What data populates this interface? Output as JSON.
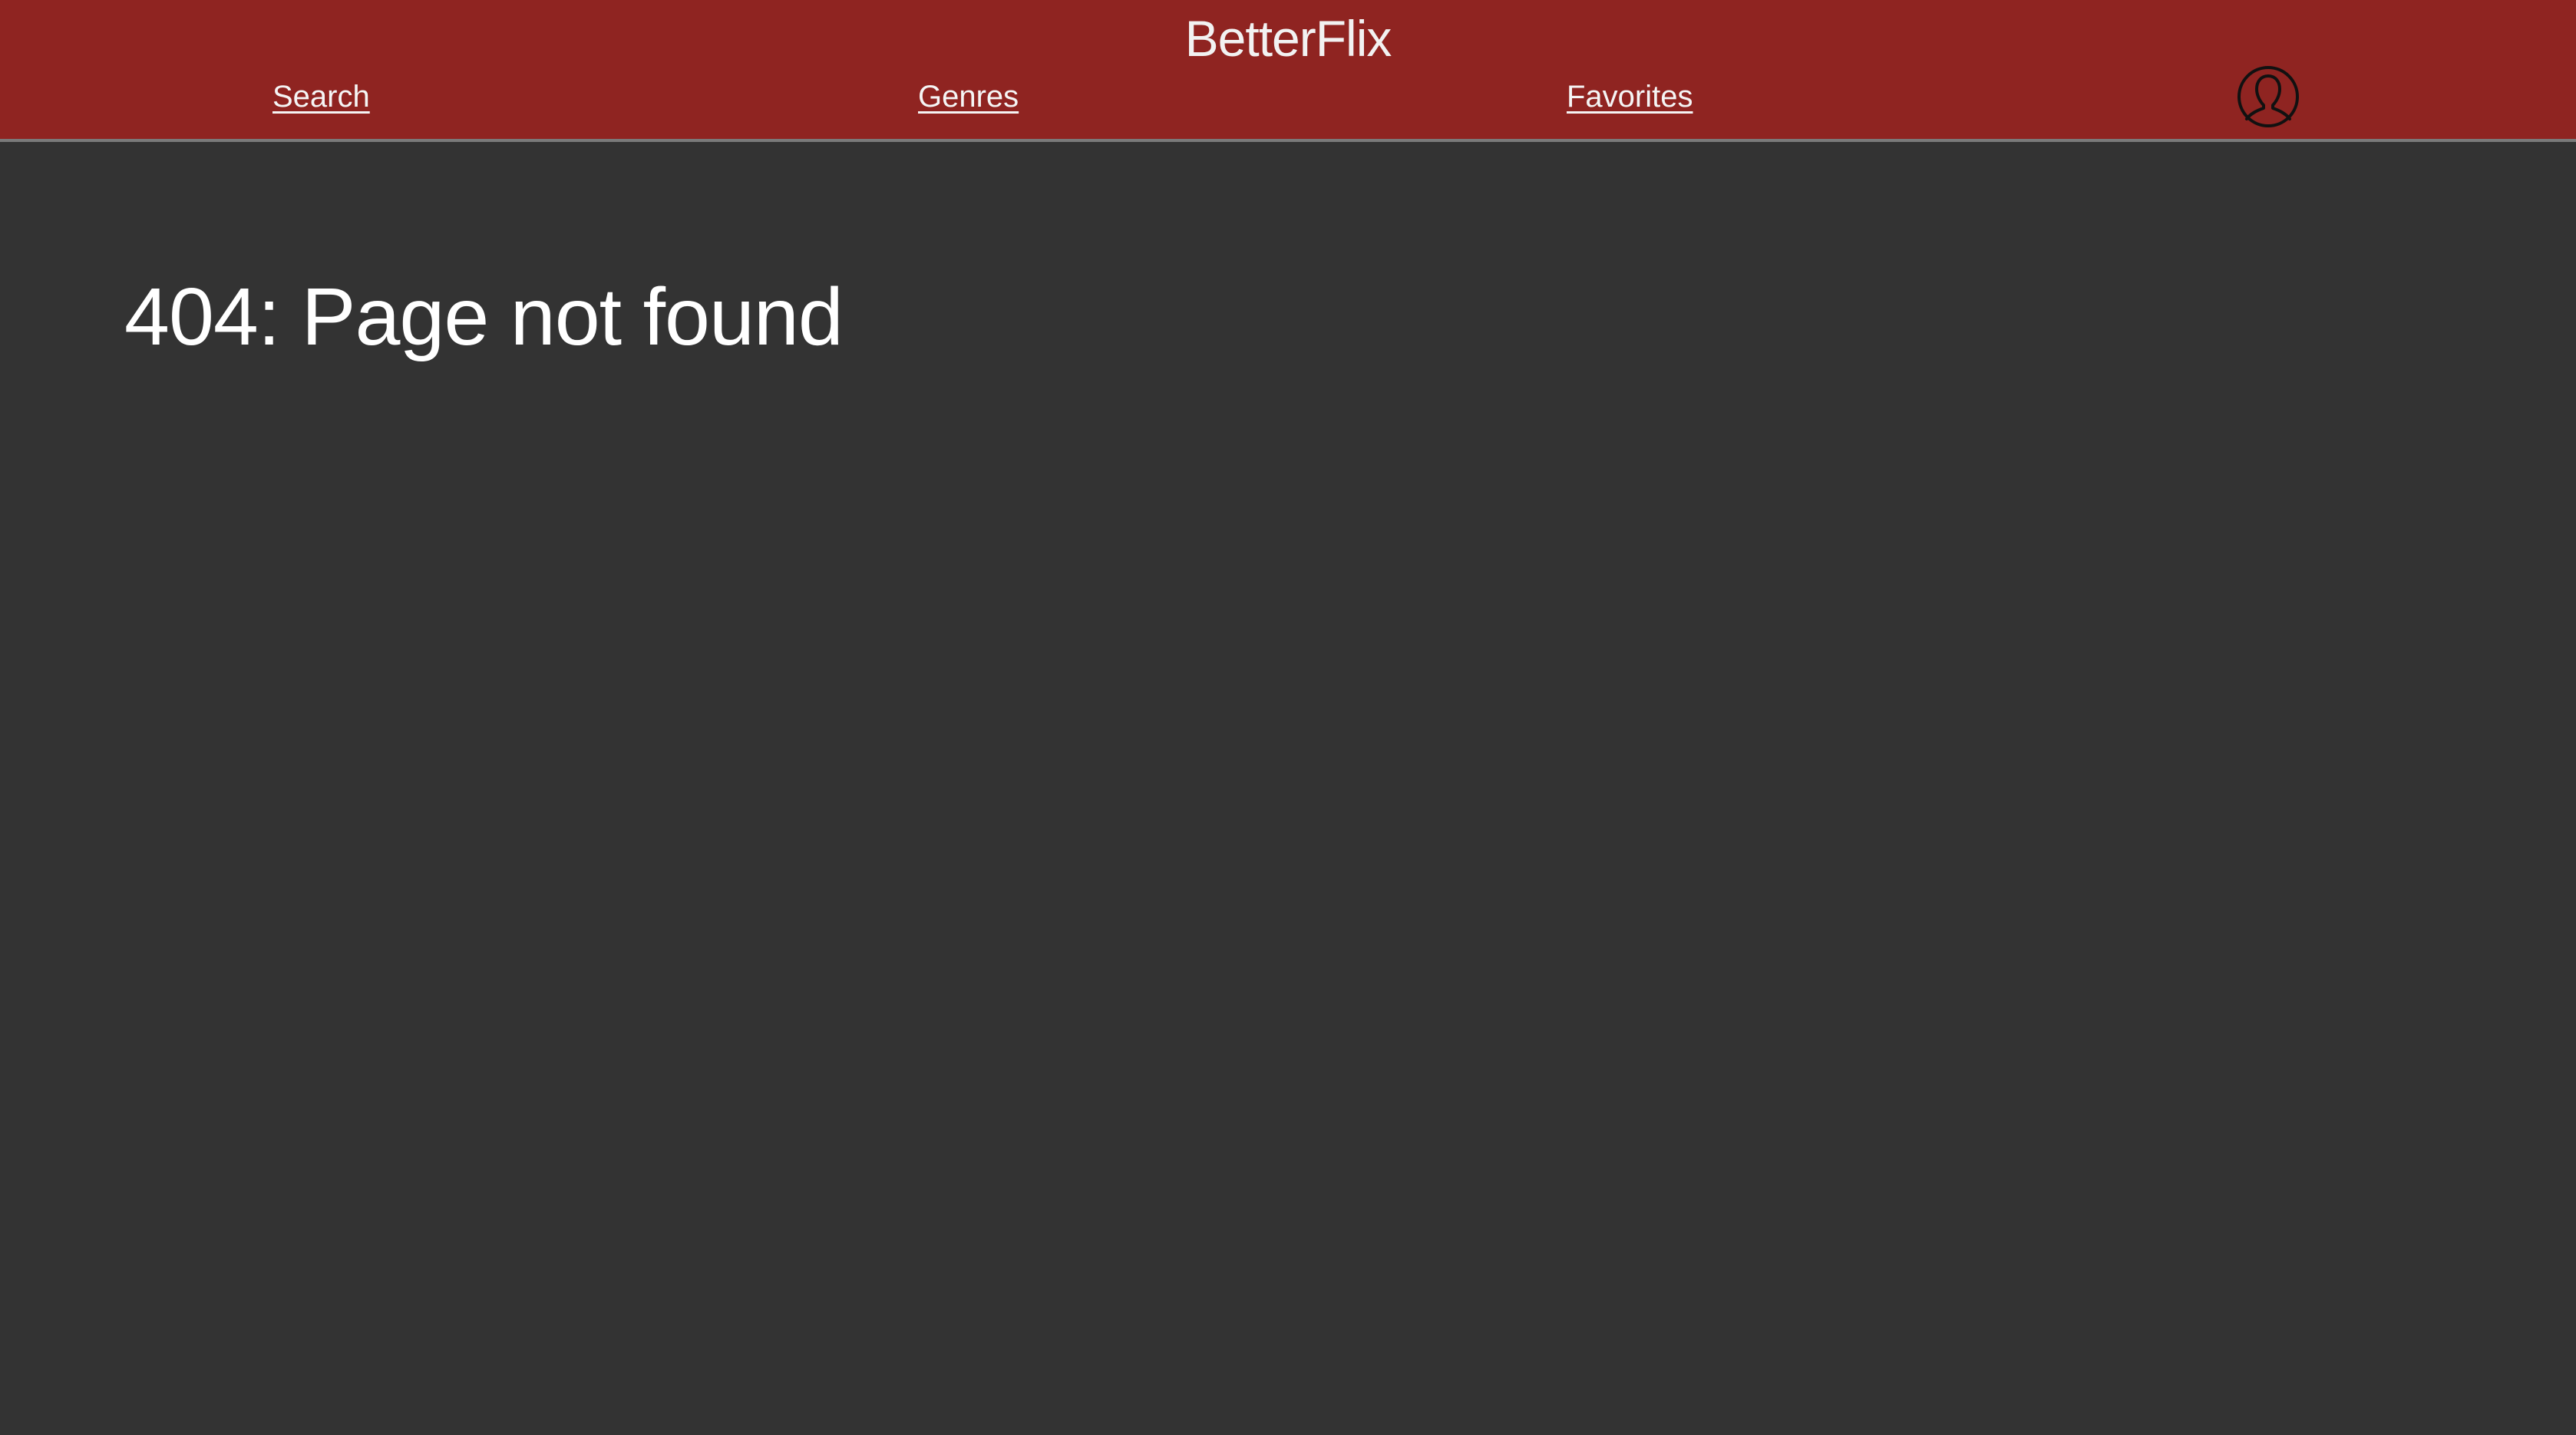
{
  "header": {
    "brand": "BetterFlix",
    "background_color": "#8f2421",
    "nav": {
      "search_label": "Search",
      "genres_label": "Genres",
      "favorites_label": "Favorites"
    },
    "avatar_icon": "user-profile-icon"
  },
  "main": {
    "background_color": "#333333",
    "title": "404: Page not found"
  }
}
